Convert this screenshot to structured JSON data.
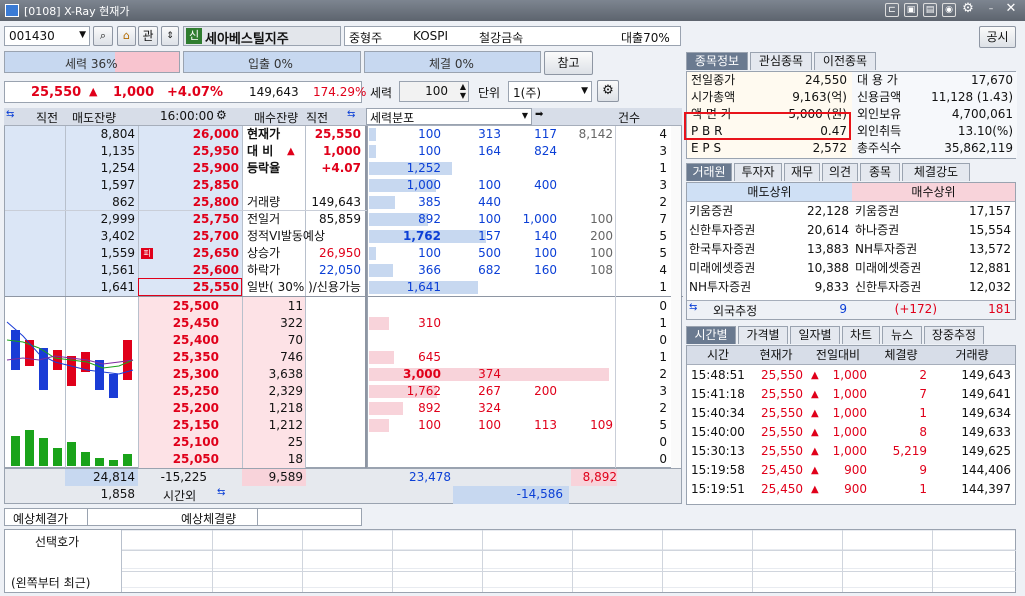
{
  "window": {
    "title": "[0108] X-Ray 현재가"
  },
  "toolbar": {
    "code": "001430",
    "kwan": "관",
    "badge": "신",
    "name": "세아베스틸지주",
    "cap": "중형주",
    "market": "KOSPI",
    "sector": "철강금속",
    "loan": "대출70%",
    "notice": "공시"
  },
  "bars": {
    "seryeok": "세력 36%",
    "ipchul": "입출 0%",
    "chegyeol": "체결 0%",
    "ref": "참고"
  },
  "quote": {
    "price": "25,550",
    "arrow": "▲",
    "change": "1,000",
    "rate": "+4.07%",
    "volume": "149,643",
    "vol_ratio": "174.29%"
  },
  "controls": {
    "seryeok_label": "세력",
    "seryeok_val": "100",
    "unit_label": "단위",
    "unit_val": "1(주)"
  },
  "ob_header": {
    "c1": "직전",
    "c2": "매도잔량",
    "time": "16:00:00",
    "c4": "매수잔량",
    "c5": "직전",
    "dist": "세력분포",
    "count": "건수"
  },
  "asks": [
    {
      "qty": "8,804",
      "price": "26,000",
      "label": "현재가",
      "value": "25,550",
      "dist": [
        "100",
        "313",
        "117",
        "8,142"
      ],
      "cnt": "4"
    },
    {
      "qty": "1,135",
      "price": "25,950",
      "label": "대 비",
      "arrow": "▲",
      "value": "1,000",
      "dist": [
        "100",
        "164",
        "824",
        ""
      ],
      "cnt": "3"
    },
    {
      "qty": "1,254",
      "price": "25,900",
      "label": "등락율",
      "value": "+4.07",
      "dist": [
        "1,252",
        "",
        "",
        ""
      ],
      "cnt": "1"
    },
    {
      "qty": "1,597",
      "price": "25,850",
      "label": "",
      "value": "",
      "dist": [
        "1,000",
        "100",
        "400",
        ""
      ],
      "cnt": "3"
    },
    {
      "qty": "862",
      "price": "25,800",
      "label": "거래량",
      "value": "149,643",
      "dist": [
        "385",
        "440",
        "",
        ""
      ],
      "cnt": "2"
    },
    {
      "qty": "2,999",
      "price": "25,750",
      "label": "전일거",
      "value": "85,859",
      "dist": [
        "892",
        "100",
        "1,000",
        "100"
      ],
      "cnt": "7"
    },
    {
      "qty": "3,402",
      "price": "25,700",
      "label": "정적VI발동예상",
      "value": "",
      "dist": [
        "1,762",
        "157",
        "140",
        "200"
      ],
      "cnt": "5"
    },
    {
      "qty": "1,559",
      "price": "25,650",
      "label": "상승가",
      "value": "26,950",
      "dist": [
        "100",
        "500",
        "100",
        "100"
      ],
      "cnt": "5",
      "mark": "피"
    },
    {
      "qty": "1,561",
      "price": "25,600",
      "label": "하락가",
      "value": "22,050",
      "dist": [
        "366",
        "682",
        "160",
        "108"
      ],
      "cnt": "4"
    },
    {
      "qty": "1,641",
      "price": "25,550",
      "label": "일반( 30% )/신용가능",
      "value": "",
      "dist": [
        "1,641",
        "",
        "",
        ""
      ],
      "cnt": "1"
    }
  ],
  "bids": [
    {
      "price": "25,500",
      "qty": "11",
      "dist": [
        "",
        "",
        "",
        ""
      ],
      "cnt": "0"
    },
    {
      "price": "25,450",
      "qty": "322",
      "dist": [
        "310",
        "",
        "",
        ""
      ],
      "cnt": "1"
    },
    {
      "price": "25,400",
      "qty": "70",
      "dist": [
        "",
        "",
        "",
        ""
      ],
      "cnt": "0"
    },
    {
      "price": "25,350",
      "qty": "746",
      "dist": [
        "645",
        "",
        "",
        ""
      ],
      "cnt": "1"
    },
    {
      "price": "25,300",
      "qty": "3,638",
      "dist": [
        "3,000",
        "374",
        "",
        ""
      ],
      "cnt": "2"
    },
    {
      "price": "25,250",
      "qty": "2,329",
      "dist": [
        "1,762",
        "267",
        "200",
        ""
      ],
      "cnt": "3"
    },
    {
      "price": "25,200",
      "qty": "1,218",
      "dist": [
        "892",
        "324",
        "",
        ""
      ],
      "cnt": "2"
    },
    {
      "price": "25,150",
      "qty": "1,212",
      "dist": [
        "100",
        "100",
        "113",
        "109"
      ],
      "cnt": "5"
    },
    {
      "price": "25,100",
      "qty": "25",
      "dist": [
        "",
        "",
        "",
        ""
      ],
      "cnt": "0"
    },
    {
      "price": "25,050",
      "qty": "18",
      "dist": [
        "",
        "",
        "",
        ""
      ],
      "cnt": "0"
    }
  ],
  "totals": {
    "ask_total": "24,814",
    "diff": "-15,225",
    "bid_total": "9,589",
    "after": "1,858",
    "after_label": "시간외",
    "dist_ask": "23,478",
    "dist_bid": "8,892",
    "dist_diff": "-14,586"
  },
  "expect": {
    "price_label": "예상체결가",
    "qty_label": "예상체결량"
  },
  "info_tabs": [
    "종목정보",
    "관심종목",
    "이전종목"
  ],
  "info": [
    {
      "k1": "전일종가",
      "v1": "24,550",
      "k2": "대 용 가",
      "v2": "17,670"
    },
    {
      "k1": "시가총액",
      "v1": "9,163(억)",
      "k2": "신용금액",
      "v2": "11,128  (1.43)"
    },
    {
      "k1": "액 면 가",
      "v1": "5,000 (원)",
      "k2": "외인보유",
      "v2": "4,700,061"
    },
    {
      "k1": "P B R",
      "v1": "0.47",
      "k2": "외인취득",
      "v2": "13.10(%)"
    },
    {
      "k1": "E P S",
      "v1": "2,572",
      "k2": "총주식수",
      "v2": "35,862,119"
    }
  ],
  "broker_tabs": [
    "거래원",
    "투자자",
    "재무",
    "의견",
    "종목",
    "체결강도"
  ],
  "broker": {
    "sell_hdr": "매도상위",
    "buy_hdr": "매수상위",
    "rows": [
      {
        "s": "키움증권",
        "sv": "22,128",
        "b": "키움증권",
        "bv": "17,157"
      },
      {
        "s": "신한투자증권",
        "sv": "20,614",
        "b": "하나증권",
        "bv": "15,554"
      },
      {
        "s": "한국투자증권",
        "sv": "13,883",
        "b": "NH투자증권",
        "bv": "13,572"
      },
      {
        "s": "미래에셋증권",
        "sv": "10,388",
        "b": "미래에셋증권",
        "bv": "12,881"
      },
      {
        "s": "NH투자증권",
        "sv": "9,833",
        "b": "신한투자증권",
        "bv": "12,032"
      }
    ],
    "foreign_label": "외국추정",
    "foreign_s": "9",
    "foreign_diff": "(+172)",
    "foreign_b": "181"
  },
  "time_tabs": [
    "시간별",
    "가격별",
    "일자별",
    "차트",
    "뉴스",
    "장중추정"
  ],
  "trades_hdr": [
    "시간",
    "현재가",
    "전일대비",
    "체결량",
    "거래량"
  ],
  "trades": [
    {
      "t": "15:48:51",
      "p": "25,550",
      "d": "1,000",
      "q": "2",
      "v": "149,643"
    },
    {
      "t": "15:41:18",
      "p": "25,550",
      "d": "1,000",
      "q": "7",
      "v": "149,641"
    },
    {
      "t": "15:40:34",
      "p": "25,550",
      "d": "1,000",
      "q": "1",
      "v": "149,634"
    },
    {
      "t": "15:40:00",
      "p": "25,550",
      "d": "1,000",
      "q": "8",
      "v": "149,633"
    },
    {
      "t": "15:30:13",
      "p": "25,550",
      "d": "1,000",
      "q": "5,219",
      "v": "149,625"
    },
    {
      "t": "15:19:58",
      "p": "25,450",
      "d": "900",
      "q": "9",
      "v": "144,406"
    },
    {
      "t": "15:19:51",
      "p": "25,450",
      "d": "900",
      "q": "1",
      "v": "144,397"
    }
  ],
  "bottom": {
    "select_label": "선택호가",
    "recent_label": "(왼쪽부터 최근)"
  }
}
